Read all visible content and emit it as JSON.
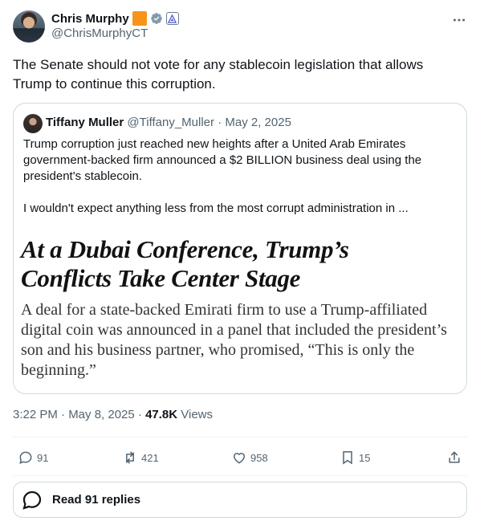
{
  "author": {
    "name": "Chris Murphy",
    "handle": "@ChrisMurphyCT",
    "badges": [
      "orange-square-badge",
      "verified-badge-icon",
      "government-badge-icon"
    ]
  },
  "post": {
    "text": "The Senate should not vote for any stablecoin legislation that allows Trump to continue this corruption."
  },
  "quote": {
    "name": "Tiffany Muller",
    "handle": "@Tiffany_Muller",
    "date": "· May 2, 2025",
    "paragraph1": "Trump corruption just reached new heights after a United Arab Emirates government-backed firm announced a $2 BILLION business deal using the president's stablecoin.",
    "paragraph2": "I wouldn't expect anything less from the most corrupt administration in ...",
    "image": {
      "headline_line1": "At a Dubai Conference, Trump’s",
      "headline_line2": "Conflicts Take Center Stage",
      "subheadline": "A deal for a state-backed Emirati firm to use a Trump-affiliated digital coin was announced in a panel that included the president’s son and his business partner, who promised, “This is only the beginning.”"
    }
  },
  "meta": {
    "time": "3:22 PM · May 8, 2025 · ",
    "views_count": "47.8K",
    "views_label": " Views"
  },
  "actions": {
    "replies": "91",
    "reposts": "421",
    "likes": "958",
    "bookmarks": "15"
  },
  "read_replies_label": "Read 91 replies",
  "colors": {
    "text": "#0f1419",
    "secondary": "#536471",
    "border": "#cfd9de",
    "divider": "#eff3f4",
    "verified": "#829aab",
    "badge_orange": "#f7931a"
  }
}
